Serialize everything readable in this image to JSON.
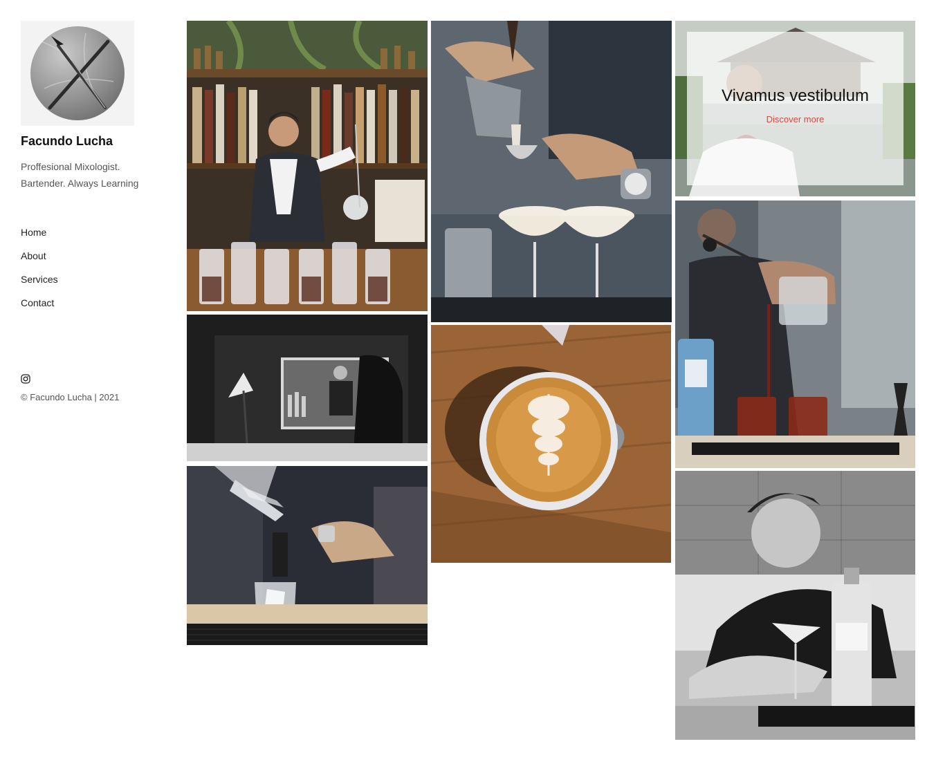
{
  "sidebar": {
    "site_name": "Facundo Lucha",
    "tagline_line1": "Proffesional Mixologist.",
    "tagline_line2": "Bartender. Always Learning",
    "nav": [
      {
        "label": "Home"
      },
      {
        "label": "About"
      },
      {
        "label": "Services"
      },
      {
        "label": "Contact"
      }
    ],
    "social_icon": "instagram-icon",
    "copyright": "© Facundo Lucha | 2021"
  },
  "gallery": {
    "featured": {
      "title": "Vivamus vestibulum",
      "link_label": "Discover more"
    }
  },
  "colors": {
    "accent_link": "#e0463a",
    "text": "#111111",
    "muted": "#555555"
  }
}
